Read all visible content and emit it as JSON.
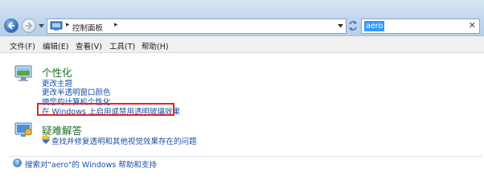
{
  "address": {
    "location": "控制面板"
  },
  "search": {
    "value": "aero"
  },
  "menu": [
    "文件(F)",
    "编辑(E)",
    "查看(V)",
    "工具(T)",
    "帮助(H)"
  ],
  "sections": {
    "personalization": {
      "title": "个性化",
      "links": [
        "更改主题",
        "更改半透明窗口颜色",
        "使您的计算机个性化",
        "在 Windows 上启用或禁用透明玻璃效果"
      ]
    },
    "troubleshooting": {
      "title": "疑难解答",
      "links": [
        "查找并修复透明和其他视觉效果存在的问题"
      ]
    }
  },
  "footer": {
    "help_link": "搜索对\"aero\"的 Windows 帮助和支持"
  }
}
